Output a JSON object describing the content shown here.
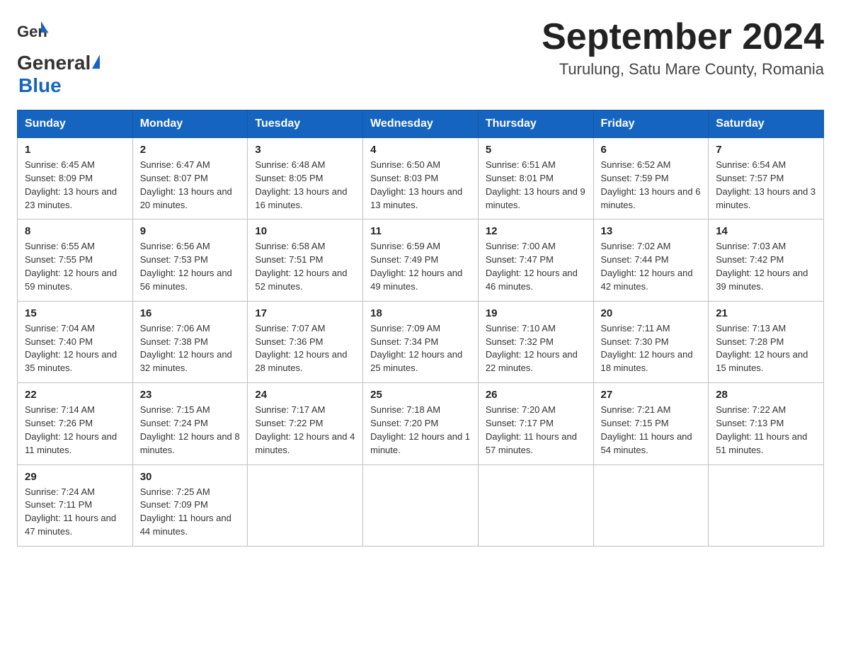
{
  "logo": {
    "general": "General",
    "blue": "Blue"
  },
  "title": "September 2024",
  "subtitle": "Turulung, Satu Mare County, Romania",
  "weekdays": [
    "Sunday",
    "Monday",
    "Tuesday",
    "Wednesday",
    "Thursday",
    "Friday",
    "Saturday"
  ],
  "weeks": [
    [
      {
        "day": "1",
        "sunrise": "6:45 AM",
        "sunset": "8:09 PM",
        "daylight": "13 hours and 23 minutes."
      },
      {
        "day": "2",
        "sunrise": "6:47 AM",
        "sunset": "8:07 PM",
        "daylight": "13 hours and 20 minutes."
      },
      {
        "day": "3",
        "sunrise": "6:48 AM",
        "sunset": "8:05 PM",
        "daylight": "13 hours and 16 minutes."
      },
      {
        "day": "4",
        "sunrise": "6:50 AM",
        "sunset": "8:03 PM",
        "daylight": "13 hours and 13 minutes."
      },
      {
        "day": "5",
        "sunrise": "6:51 AM",
        "sunset": "8:01 PM",
        "daylight": "13 hours and 9 minutes."
      },
      {
        "day": "6",
        "sunrise": "6:52 AM",
        "sunset": "7:59 PM",
        "daylight": "13 hours and 6 minutes."
      },
      {
        "day": "7",
        "sunrise": "6:54 AM",
        "sunset": "7:57 PM",
        "daylight": "13 hours and 3 minutes."
      }
    ],
    [
      {
        "day": "8",
        "sunrise": "6:55 AM",
        "sunset": "7:55 PM",
        "daylight": "12 hours and 59 minutes."
      },
      {
        "day": "9",
        "sunrise": "6:56 AM",
        "sunset": "7:53 PM",
        "daylight": "12 hours and 56 minutes."
      },
      {
        "day": "10",
        "sunrise": "6:58 AM",
        "sunset": "7:51 PM",
        "daylight": "12 hours and 52 minutes."
      },
      {
        "day": "11",
        "sunrise": "6:59 AM",
        "sunset": "7:49 PM",
        "daylight": "12 hours and 49 minutes."
      },
      {
        "day": "12",
        "sunrise": "7:00 AM",
        "sunset": "7:47 PM",
        "daylight": "12 hours and 46 minutes."
      },
      {
        "day": "13",
        "sunrise": "7:02 AM",
        "sunset": "7:44 PM",
        "daylight": "12 hours and 42 minutes."
      },
      {
        "day": "14",
        "sunrise": "7:03 AM",
        "sunset": "7:42 PM",
        "daylight": "12 hours and 39 minutes."
      }
    ],
    [
      {
        "day": "15",
        "sunrise": "7:04 AM",
        "sunset": "7:40 PM",
        "daylight": "12 hours and 35 minutes."
      },
      {
        "day": "16",
        "sunrise": "7:06 AM",
        "sunset": "7:38 PM",
        "daylight": "12 hours and 32 minutes."
      },
      {
        "day": "17",
        "sunrise": "7:07 AM",
        "sunset": "7:36 PM",
        "daylight": "12 hours and 28 minutes."
      },
      {
        "day": "18",
        "sunrise": "7:09 AM",
        "sunset": "7:34 PM",
        "daylight": "12 hours and 25 minutes."
      },
      {
        "day": "19",
        "sunrise": "7:10 AM",
        "sunset": "7:32 PM",
        "daylight": "12 hours and 22 minutes."
      },
      {
        "day": "20",
        "sunrise": "7:11 AM",
        "sunset": "7:30 PM",
        "daylight": "12 hours and 18 minutes."
      },
      {
        "day": "21",
        "sunrise": "7:13 AM",
        "sunset": "7:28 PM",
        "daylight": "12 hours and 15 minutes."
      }
    ],
    [
      {
        "day": "22",
        "sunrise": "7:14 AM",
        "sunset": "7:26 PM",
        "daylight": "12 hours and 11 minutes."
      },
      {
        "day": "23",
        "sunrise": "7:15 AM",
        "sunset": "7:24 PM",
        "daylight": "12 hours and 8 minutes."
      },
      {
        "day": "24",
        "sunrise": "7:17 AM",
        "sunset": "7:22 PM",
        "daylight": "12 hours and 4 minutes."
      },
      {
        "day": "25",
        "sunrise": "7:18 AM",
        "sunset": "7:20 PM",
        "daylight": "12 hours and 1 minute."
      },
      {
        "day": "26",
        "sunrise": "7:20 AM",
        "sunset": "7:17 PM",
        "daylight": "11 hours and 57 minutes."
      },
      {
        "day": "27",
        "sunrise": "7:21 AM",
        "sunset": "7:15 PM",
        "daylight": "11 hours and 54 minutes."
      },
      {
        "day": "28",
        "sunrise": "7:22 AM",
        "sunset": "7:13 PM",
        "daylight": "11 hours and 51 minutes."
      }
    ],
    [
      {
        "day": "29",
        "sunrise": "7:24 AM",
        "sunset": "7:11 PM",
        "daylight": "11 hours and 47 minutes."
      },
      {
        "day": "30",
        "sunrise": "7:25 AM",
        "sunset": "7:09 PM",
        "daylight": "11 hours and 44 minutes."
      },
      null,
      null,
      null,
      null,
      null
    ]
  ]
}
